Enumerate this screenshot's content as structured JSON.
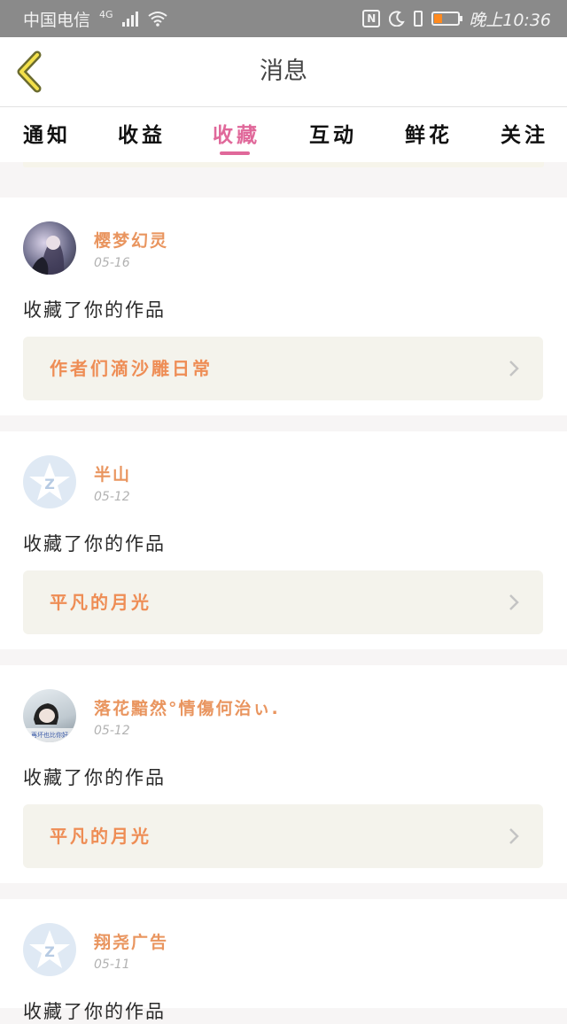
{
  "status_bar": {
    "carrier": "中国电信",
    "network": "4G",
    "time": "晚上10:36",
    "battery_level": 0.35,
    "battery_color": "#ff8a1f"
  },
  "header": {
    "back_icon": "chevron-left-icon",
    "title": "消息"
  },
  "tabs": [
    {
      "label": "通知"
    },
    {
      "label": "收益"
    },
    {
      "label": "收藏"
    },
    {
      "label": "互动"
    },
    {
      "label": "鲜花"
    },
    {
      "label": "关注"
    }
  ],
  "active_tab": "收藏",
  "accent_color": "#e0689a",
  "name_color": "#e9955f",
  "messages": [
    {
      "user": "樱梦幻灵",
      "date": "05-16",
      "action": "收藏了你的作品",
      "work": "作者们滴沙雕日常",
      "avatar": "photo"
    },
    {
      "user": "半山",
      "date": "05-12",
      "action": "收藏了你的作品",
      "work": "平凡的月光",
      "avatar": "default-star-avatar"
    },
    {
      "user": "落花黯然°情傷何治ぃ.",
      "date": "05-12",
      "action": "收藏了你的作品",
      "work": "平凡的月光",
      "avatar": "photo",
      "avatar_caption": "再坏也比你好"
    },
    {
      "user": "翔尧广告",
      "date": "05-11",
      "action": "收藏了你的作品",
      "avatar": "default-star-avatar"
    }
  ]
}
